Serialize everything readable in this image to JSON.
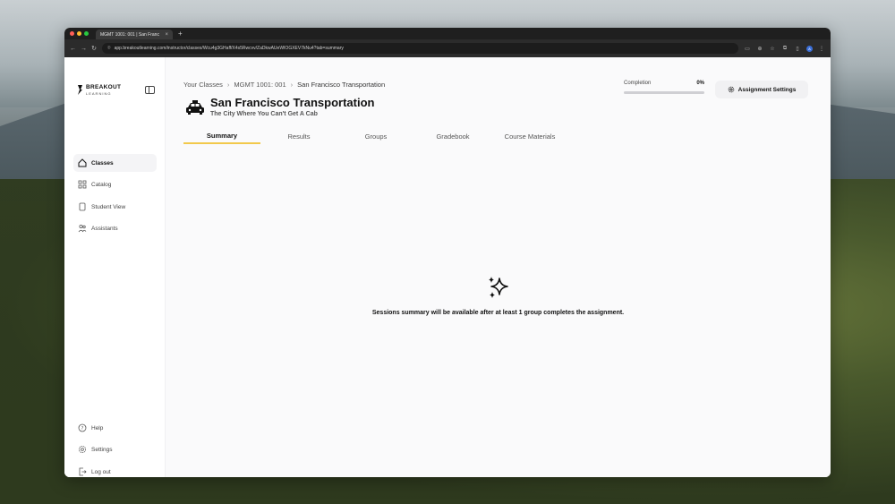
{
  "browser": {
    "tab_title": "MGMT 1001: 001 | San Franc",
    "url": "app.breakoutlearning.com/instructor/classes/Wcu4g3GHaff/X4s5Rwcvv/ZaDkwAUeWIOGXEV7kNu4?tab=summary"
  },
  "sidebar": {
    "brand": "BREAKOUT",
    "brand_sub": "LEARNING",
    "items": [
      {
        "label": "Classes",
        "icon": "home-icon"
      },
      {
        "label": "Catalog",
        "icon": "grid-icon"
      },
      {
        "label": "Student View",
        "icon": "document-icon"
      },
      {
        "label": "Assistants",
        "icon": "users-icon"
      }
    ],
    "footer": [
      {
        "label": "Help",
        "icon": "help-icon"
      },
      {
        "label": "Settings",
        "icon": "gear-icon"
      },
      {
        "label": "Log out",
        "icon": "logout-icon"
      }
    ]
  },
  "breadcrumb": [
    "Your Classes",
    "MGMT 1001: 001",
    "San Francisco Transportation"
  ],
  "page": {
    "title": "San Francisco Transportation",
    "subtitle": "The City Where You Can't Get A Cab"
  },
  "tabs": [
    "Summary",
    "Results",
    "Groups",
    "Gradebook",
    "Course Materials"
  ],
  "completion": {
    "label": "Completion",
    "value": "0%",
    "progress": 0
  },
  "assignment_settings_label": "Assignment Settings",
  "empty_state": {
    "message": "Sessions summary will be available after at least 1 group completes the assignment."
  },
  "colors": {
    "tab_accent": "#f2c94c",
    "progress_track": "#cfcfd3"
  }
}
